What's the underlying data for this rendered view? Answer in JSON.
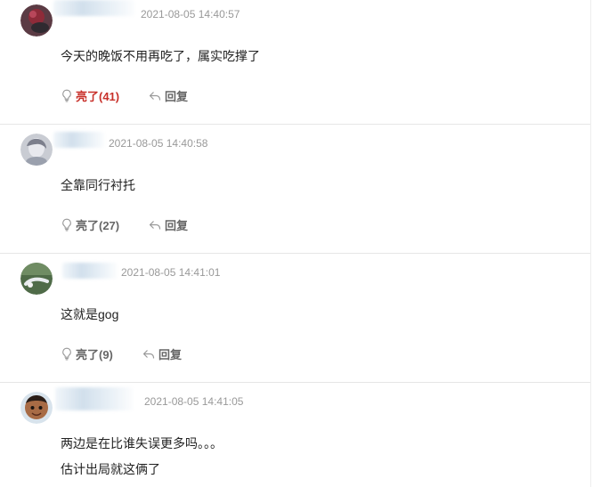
{
  "comments": [
    {
      "timestamp": "2021-08-05 14:40:57",
      "lines": [
        "今天的晚饭不用再吃了，属实吃撑了"
      ],
      "like_label": "亮了(41)",
      "reply_label": "回复"
    },
    {
      "timestamp": "2021-08-05 14:40:58",
      "lines": [
        "全靠同行衬托"
      ],
      "like_label": "亮了(27)",
      "reply_label": "回复"
    },
    {
      "timestamp": "2021-08-05 14:41:01",
      "lines": [
        "这就是gog"
      ],
      "like_label": "亮了(9)",
      "reply_label": "回复"
    },
    {
      "timestamp": "2021-08-05 14:41:05",
      "lines": [
        "两边是在比谁失误更多吗。。。",
        "估计出局就这俩了"
      ]
    }
  ],
  "colors": {
    "liked_accent": "#c8302a",
    "action_gray": "#666666",
    "timestamp_gray": "#999999"
  },
  "icons": {
    "like": "lightbulb-icon",
    "reply": "reply-arrow-icon"
  }
}
